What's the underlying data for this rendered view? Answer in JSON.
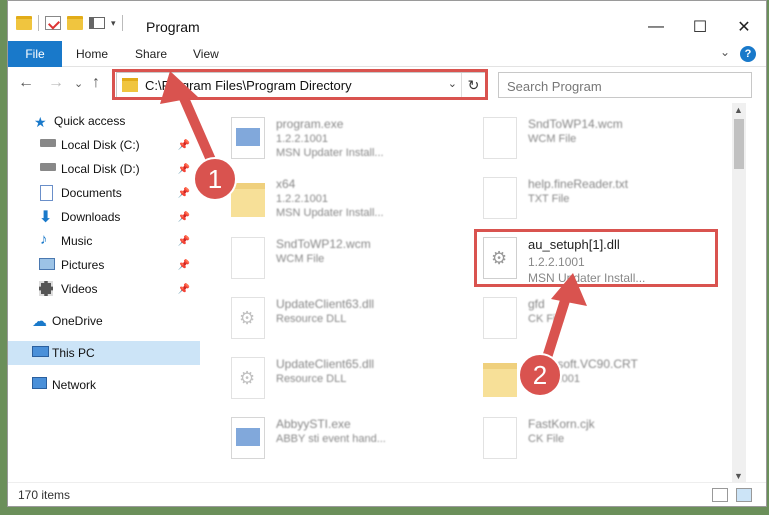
{
  "window": {
    "title": "Program",
    "controls": {
      "minimize": "—",
      "maximize": "☐",
      "close": "✕"
    }
  },
  "ribbon": {
    "tabs": [
      "File",
      "Home",
      "Share",
      "View"
    ],
    "help": "?",
    "expand": "⌄"
  },
  "nav": {
    "back": "←",
    "forward": "→",
    "recent": "⌄",
    "up": "↑",
    "address": "C:\\Program Files\\Program Directory",
    "refresh": "↻",
    "search_placeholder": "Search Program"
  },
  "sidebar": {
    "items": [
      {
        "label": "Quick access",
        "icon": "star-icon",
        "pinned": false
      },
      {
        "label": "Local Disk (C:)",
        "icon": "drive-icon",
        "pinned": true
      },
      {
        "label": "Local Disk (D:)",
        "icon": "drive-icon",
        "pinned": true
      },
      {
        "label": "Documents",
        "icon": "documents-icon",
        "pinned": true
      },
      {
        "label": "Downloads",
        "icon": "download-icon",
        "pinned": true
      },
      {
        "label": "Music",
        "icon": "music-icon",
        "pinned": true
      },
      {
        "label": "Pictures",
        "icon": "pictures-icon",
        "pinned": true
      },
      {
        "label": "Videos",
        "icon": "videos-icon",
        "pinned": true
      },
      {
        "label": "OneDrive",
        "icon": "cloud-icon",
        "pinned": false
      },
      {
        "label": "This PC",
        "icon": "pc-icon",
        "pinned": false,
        "selected": true
      },
      {
        "label": "Network",
        "icon": "network-icon",
        "pinned": false
      }
    ],
    "pin_glyph": "📌"
  },
  "files": [
    {
      "name": "program.exe",
      "line2": "1.2.2.1001",
      "line3": "MSN Updater Install...",
      "kind": "exe"
    },
    {
      "name": "SndToWP14.wcm",
      "line2": "WCM File",
      "line3": "",
      "kind": "doc"
    },
    {
      "name": "x64",
      "line2": "1.2.2.1001",
      "line3": "MSN Updater Install...",
      "kind": "folder"
    },
    {
      "name": "help.fineReader.txt",
      "line2": "TXT File",
      "line3": "",
      "kind": "doc"
    },
    {
      "name": "SndToWP12.wcm",
      "line2": "WCM File",
      "line3": "",
      "kind": "doc"
    },
    {
      "name": "au_setuph[1].dll",
      "line2": "1.2.2.1001",
      "line3": "MSN Updater Install...",
      "kind": "dll",
      "highlight": true
    },
    {
      "name": "UpdateClient63.dll",
      "line2": "Resource DLL",
      "line3": "",
      "kind": "dll"
    },
    {
      "name": "gfd",
      "line2": "CK File",
      "line3": "",
      "kind": "doc"
    },
    {
      "name": "UpdateClient65.dll",
      "line2": "Resource DLL",
      "line3": "",
      "kind": "dll"
    },
    {
      "name": "Microsoft.VC90.CRT",
      "line2": "1.2.2.1001",
      "line3": "",
      "kind": "folder"
    },
    {
      "name": "AbbyySTI.exe",
      "line2": "ABBY sti event hand...",
      "line3": "",
      "kind": "exe"
    },
    {
      "name": "FastKorn.cjk",
      "line2": "CK File",
      "line3": "",
      "kind": "doc"
    }
  ],
  "status": {
    "count": "170 items"
  },
  "callouts": [
    "1",
    "2"
  ],
  "colors": {
    "accent": "#1979ca",
    "highlight": "#d9534f"
  }
}
